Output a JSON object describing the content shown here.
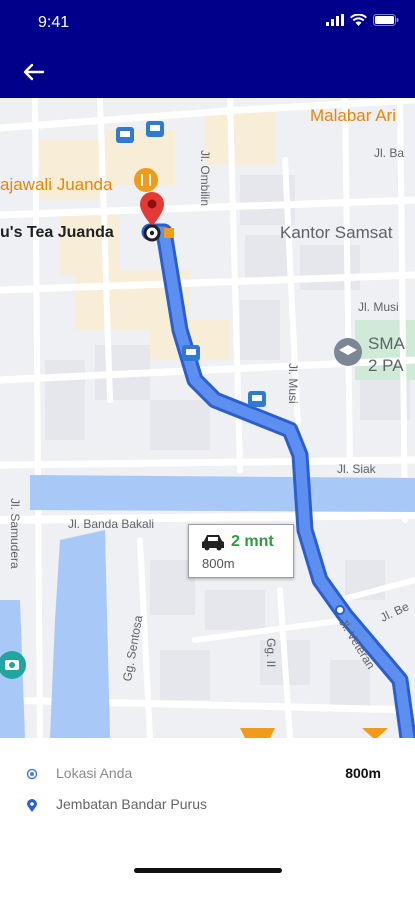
{
  "status_bar": {
    "time": "9:41"
  },
  "app_bar": {
    "back_icon": "arrow-left-icon"
  },
  "map": {
    "poi": {
      "malabar": "Malabar Ari",
      "rajawali": "ajawali Juanda",
      "tea": "u's Tea Juanda",
      "samsat": "Kantor Samsat",
      "sma": "SMA",
      "sma2": "2 PA"
    },
    "streets": {
      "ombilin": "Jl. Ombilin",
      "ba": "Jl. Ba",
      "musi_h": "Jl. Musi",
      "musi_v": "Jl. Musi",
      "siak": "Jl. Siak",
      "banda_bakali": "Jl. Banda Bakali",
      "samudera": "Jl. Samudera",
      "sentosa": "Gg. Sentosa",
      "gg_ii": "Gg. II",
      "veteran": "Jl. Veteran",
      "be": "Jl. Be"
    },
    "eta": {
      "duration": "2 mnt",
      "distance": "800m",
      "mode_icon": "car-icon"
    },
    "colors": {
      "route": "#4a7ee8",
      "route_border": "#2d5fcc",
      "water": "#a8c8f8",
      "pin": "#e53935",
      "header": "#00008b"
    }
  },
  "route_info": {
    "origin_label": "Lokasi Anda",
    "distance": "800m",
    "destination_label": "Jembatan Bandar Purus"
  }
}
